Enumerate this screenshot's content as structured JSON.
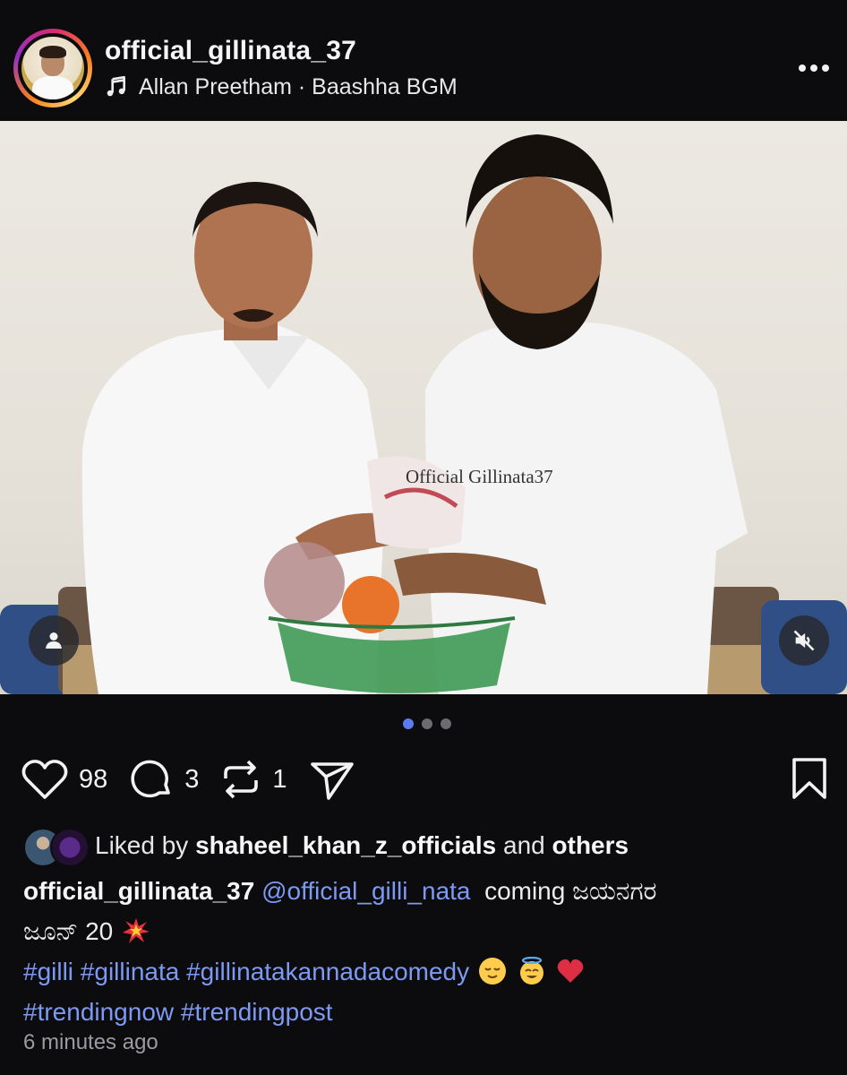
{
  "post": {
    "username": "official_gillinata_37",
    "audio": "Allan Preetham · Baashha BGM",
    "watermark": "Official Gillinata37"
  },
  "carousel": {
    "current": 1,
    "total": 3
  },
  "actions": {
    "likes": "98",
    "comments": "3",
    "reposts": "1"
  },
  "liked_by": {
    "prefix": "Liked by",
    "user": "shaheel_khan_z_officials",
    "middle": "and",
    "others": "others"
  },
  "caption": {
    "author": "official_gillinata_37",
    "mention": "@official_gilli_nata",
    "text_line1": "coming ಜಯನಗರ",
    "text_line2": "ಜೂನ್ 20",
    "hashtags_line1": "#gilli #gillinata #gillinatakannadacomedy",
    "hashtags_line2": "#trendingnow #trendingpost"
  },
  "timestamp": "6 minutes ago",
  "icons": {
    "music": "music-note-icon",
    "more": "more-options-icon",
    "tag": "tagged-people-icon",
    "mute": "muted-speaker-icon",
    "like": "heart-icon",
    "comment": "comment-icon",
    "repost": "repost-icon",
    "share": "send-icon",
    "save": "bookmark-icon"
  },
  "colors": {
    "background": "#0c0c0e",
    "link": "#7d9af2",
    "active_dot": "#5b7cf0"
  }
}
